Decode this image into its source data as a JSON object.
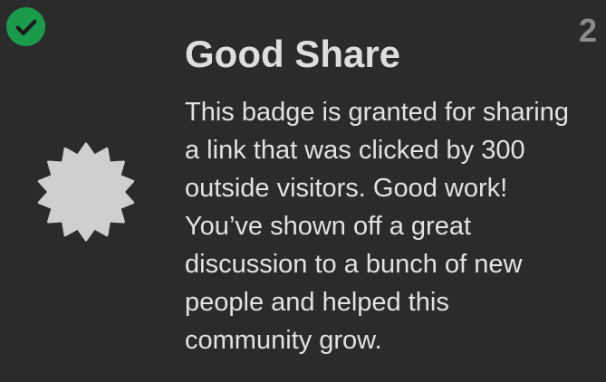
{
  "badge": {
    "title": "Good Share",
    "description": "This badge is granted for sharing a link that was clicked by 300 outside visitors. Good work! You’ve shown off a great discussion to a bunch of new people and helped this community grow.",
    "count": "2",
    "granted_icon": "check-circle-icon",
    "badge_icon": "starburst-icon",
    "colors": {
      "background": "#2b2b2b",
      "check": "#1a9b4b",
      "badge_shape": "#cfcfcf",
      "count": "#8c8c8c"
    }
  }
}
